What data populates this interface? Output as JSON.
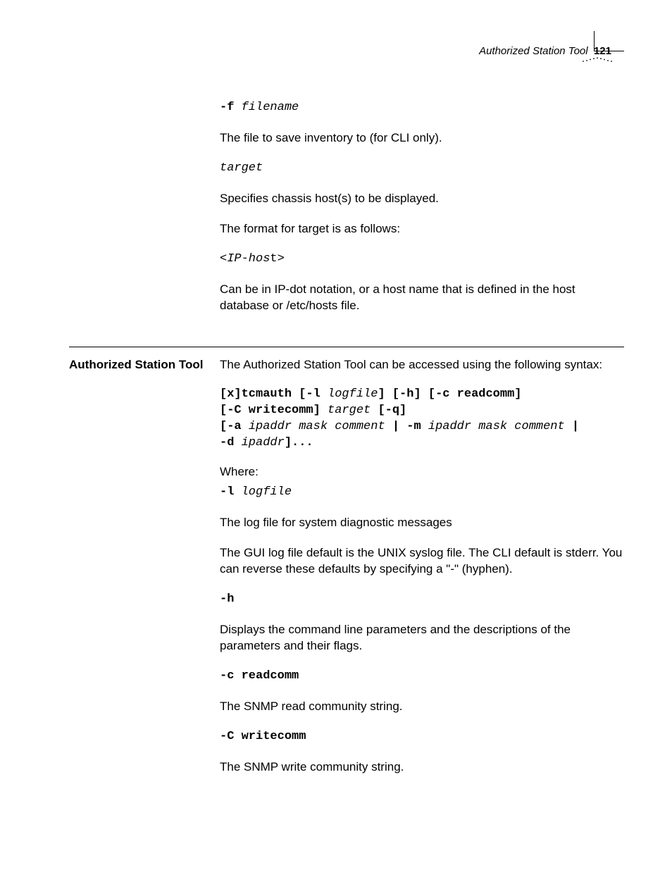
{
  "header": {
    "title": "Authorized Station Tool",
    "page_number": "121"
  },
  "sections": [
    {
      "heading": "",
      "blocks": [
        {
          "type": "opt",
          "flag": "-f",
          "arg": "filename"
        },
        {
          "type": "p",
          "text": "The file to save inventory to (for CLI only)."
        },
        {
          "type": "argline",
          "arg": "target"
        },
        {
          "type": "p",
          "text": "Specifies chassis host(s) to be displayed."
        },
        {
          "type": "p",
          "text": "The format for target is as follows:"
        },
        {
          "type": "iphost",
          "open": "<",
          "arg": "IP-hos",
          "trail": "t",
          "close": ">"
        },
        {
          "type": "p",
          "text": "Can be in IP-dot notation, or a host name that is defined in the host database or /etc/hosts file."
        }
      ]
    },
    {
      "heading": "Authorized Station Tool",
      "blocks": [
        {
          "type": "p",
          "text": "The Authorized Station Tool can be accessed using the following syntax:"
        },
        {
          "type": "syntax",
          "parts": [
            {
              "b": "[x]tcmauth [-l "
            },
            {
              "a": "logfile"
            },
            {
              "b": "] [-h] [-c readcomm]"
            },
            {
              "nl": true
            },
            {
              "b": "[-C writecomm] "
            },
            {
              "a": "target"
            },
            {
              "b": " [-q]"
            },
            {
              "nl": true
            },
            {
              "b": "[-a "
            },
            {
              "a": "ipaddr mask comment"
            },
            {
              "b": " | -m "
            },
            {
              "a": "ipaddr mask comment"
            },
            {
              "b": " |"
            },
            {
              "nl": true
            },
            {
              "b": "-d "
            },
            {
              "a": "ipaddr"
            },
            {
              "b": "]..."
            }
          ]
        },
        {
          "type": "p",
          "text": "Where:"
        },
        {
          "type": "opt",
          "flag": "-l",
          "arg": "logfile"
        },
        {
          "type": "p",
          "text": "The log file for system diagnostic messages"
        },
        {
          "type": "p",
          "text": "The GUI log file default is the UNIX syslog file. The CLI default is stderr. You can reverse these defaults by specifying a \"-\" (hyphen)."
        },
        {
          "type": "flag",
          "flag": "-h"
        },
        {
          "type": "p",
          "text": "Displays the command line parameters and the descriptions of the parameters and their flags."
        },
        {
          "type": "flag",
          "flag": "-c readcomm"
        },
        {
          "type": "p",
          "text": "The SNMP read community string."
        },
        {
          "type": "flag",
          "flag": "-C writecomm"
        },
        {
          "type": "p",
          "text": "The SNMP write community string."
        }
      ]
    }
  ]
}
